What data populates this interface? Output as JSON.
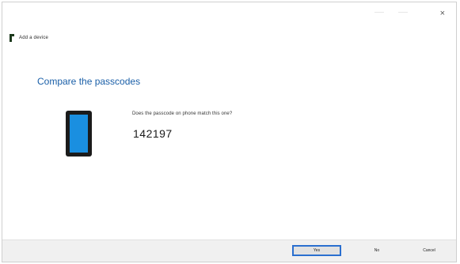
{
  "window": {
    "close_glyph": "×"
  },
  "header": {
    "icon": "add-device-icon",
    "title": "Add a device"
  },
  "main": {
    "title": "Compare the passcodes",
    "question": "Does the passcode on phone match this one?",
    "passcode": "142197",
    "device_icon": "phone-icon"
  },
  "footer": {
    "yes_label": "Yes",
    "no_label": "No",
    "cancel_label": "Cancel"
  },
  "colors": {
    "title": "#1a5fa8",
    "device_screen": "#1a8fe0",
    "primary_border": "#2a6fcf"
  }
}
